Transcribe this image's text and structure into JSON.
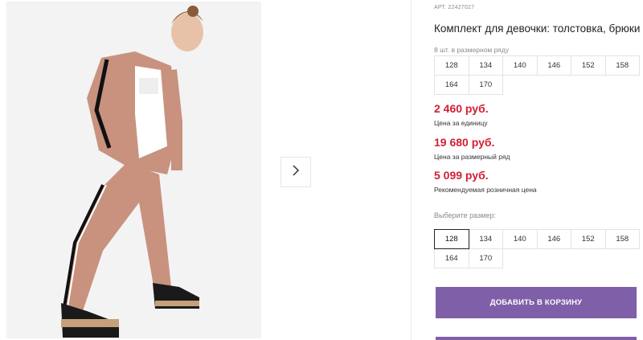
{
  "gallery": {
    "next_icon": "chevron-right-icon"
  },
  "product": {
    "article": "АРТ. 22427027",
    "title": "Комплект для девочки: толстовка, брюки",
    "size_row_label": "8 шт. в размерном ряду",
    "size_row": [
      "128",
      "134",
      "140",
      "146",
      "152",
      "158",
      "164",
      "170"
    ],
    "prices": [
      {
        "value": "2 460 руб.",
        "note": "Цена за единицу"
      },
      {
        "value": "19 680 руб.",
        "note": "Цена за размерный ряд"
      },
      {
        "value": "5 099 руб.",
        "note": "Рекомендуемая розничная цена"
      }
    ],
    "choose_size_label": "Выберите размер:",
    "sizes": [
      "128",
      "134",
      "140",
      "146",
      "152",
      "158",
      "164",
      "170"
    ],
    "selected_size": "128",
    "add_to_cart": "ДОБАВИТЬ В КОРЗИНУ"
  },
  "colors": {
    "accent": "#7e5fa8",
    "price": "#d21f32"
  }
}
